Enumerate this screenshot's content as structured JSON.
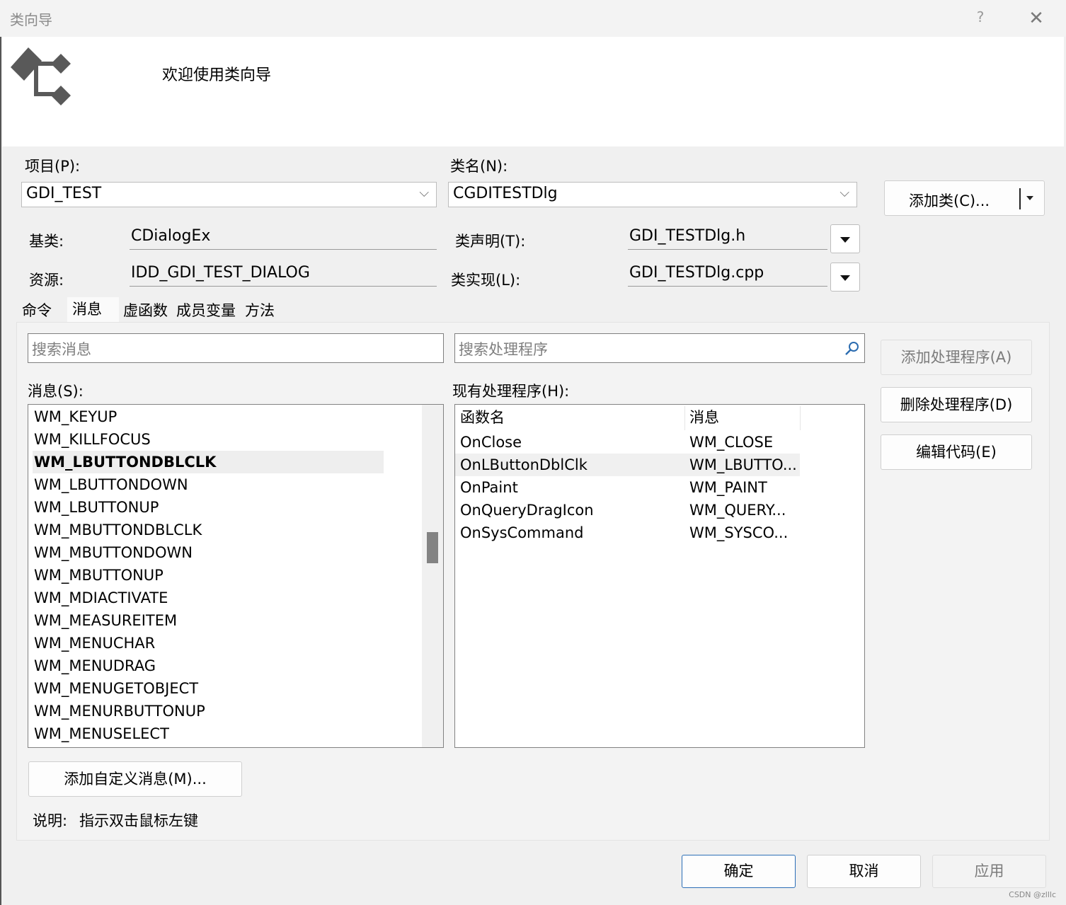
{
  "window": {
    "title": "类向导",
    "help_label": "?",
    "close_label": "✕"
  },
  "banner": {
    "title": "欢迎使用类向导",
    "logo_icon": "class-wizard-icon"
  },
  "project": {
    "label": "项目(P):",
    "value": "GDI_TEST"
  },
  "classname": {
    "label": "类名(N):",
    "value": "CGDITESTDlg"
  },
  "add_class": {
    "label": "添加类(C)..."
  },
  "base_class": {
    "label": "基类:",
    "value": "CDialogEx"
  },
  "resource": {
    "label": "资源:",
    "value": "IDD_GDI_TEST_DIALOG"
  },
  "class_decl": {
    "label": "类声明(T):",
    "value": "GDI_TESTDlg.h"
  },
  "class_impl": {
    "label": "类实现(L):",
    "value": "GDI_TESTDlg.cpp"
  },
  "tabs": [
    {
      "label": "命令"
    },
    {
      "label": "消息"
    },
    {
      "label": "虚函数"
    },
    {
      "label": "成员变量"
    },
    {
      "label": "方法"
    }
  ],
  "messages": {
    "search_placeholder": "搜索消息",
    "label": "消息(S):",
    "items": [
      "WM_KEYUP",
      "WM_KILLFOCUS",
      "WM_LBUTTONDBLCLK",
      "WM_LBUTTONDOWN",
      "WM_LBUTTONUP",
      "WM_MBUTTONDBLCLK",
      "WM_MBUTTONDOWN",
      "WM_MBUTTONUP",
      "WM_MDIACTIVATE",
      "WM_MEASUREITEM",
      "WM_MENUCHAR",
      "WM_MENUDRAG",
      "WM_MENUGETOBJECT",
      "WM_MENURBUTTONUP",
      "WM_MENUSELECT"
    ],
    "selected": "WM_LBUTTONDBLCLK"
  },
  "handlers": {
    "search_placeholder": "搜索处理程序",
    "label": "现有处理程序(H):",
    "columns": [
      "函数名",
      "消息"
    ],
    "rows": [
      [
        "OnClose",
        "WM_CLOSE"
      ],
      [
        "OnLButtonDblClk",
        "WM_LBUTTO..."
      ],
      [
        "OnPaint",
        "WM_PAINT"
      ],
      [
        "OnQueryDragIcon",
        "WM_QUERY..."
      ],
      [
        "OnSysCommand",
        "WM_SYSCO..."
      ]
    ],
    "selected": "OnLButtonDblClk"
  },
  "buttons": {
    "add_handler": "添加处理程序(A)",
    "delete_handler": "删除处理程序(D)",
    "edit_code": "编辑代码(E)",
    "add_custom_message": "添加自定义消息(M)...",
    "ok": "确定",
    "cancel": "取消",
    "apply": "应用"
  },
  "description": {
    "label": "说明:",
    "text": "指示双击鼠标左键"
  },
  "watermark": "CSDN @zlllc"
}
